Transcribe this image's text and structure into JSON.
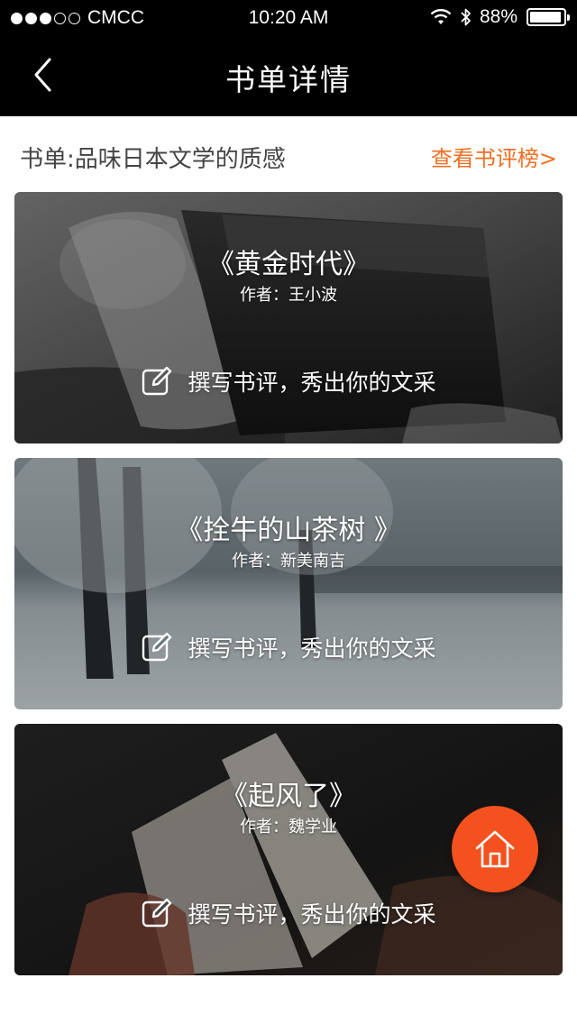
{
  "status_bar": {
    "carrier": "CMCC",
    "time": "10:20 AM",
    "battery": "88%",
    "signal_dots_filled": 3,
    "signal_dots_total": 5
  },
  "nav": {
    "title": "书单详情",
    "back_icon": "chevron-left-icon"
  },
  "list_header": {
    "title": "书单:品味日本文学的质感",
    "link": "查看书评榜>"
  },
  "books": [
    {
      "title": "《黄金时代》",
      "author": "作者：王小波",
      "action": "撰写书评，秀出你的文采"
    },
    {
      "title": "《拴牛的山茶树 》",
      "author": "作者：新美南吉",
      "action": "撰写书评，秀出你的文采"
    },
    {
      "title": "《起风了》",
      "author": "作者：魏学业",
      "action": "撰写书评，秀出你的文采"
    }
  ],
  "colors": {
    "accent": "#f26d21",
    "fab": "#f4511e",
    "bar": "#000000"
  },
  "fab": {
    "icon": "home-icon"
  }
}
